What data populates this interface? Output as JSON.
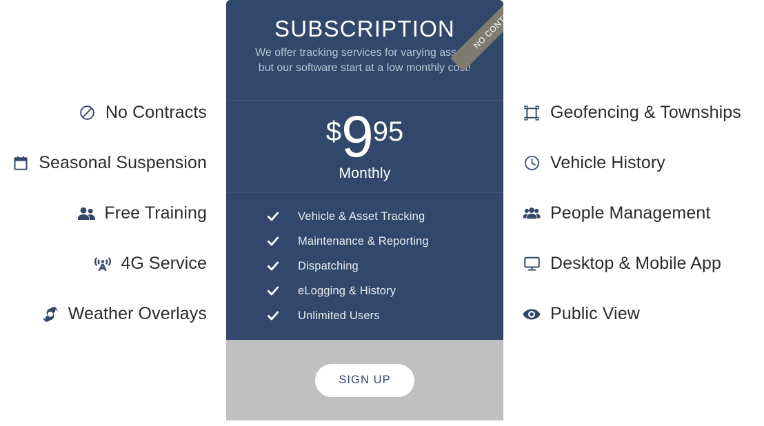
{
  "card": {
    "title": "SUBSCRIPTION",
    "subtitle": "We offer tracking services for varying assets, but our software start at a low monthly cost!",
    "ribbon_text": "NO CONTRACT",
    "price": {
      "currency": "$",
      "amount": "9",
      "cents": "95",
      "period": "Monthly"
    },
    "included": [
      {
        "label": "Vehicle & Asset Tracking",
        "icon": "check-icon"
      },
      {
        "label": "Maintenance & Reporting",
        "icon": "check-icon"
      },
      {
        "label": "Dispatching",
        "icon": "check-icon"
      },
      {
        "label": "eLogging & History",
        "icon": "check-icon"
      },
      {
        "label": "Unlimited Users",
        "icon": "check-icon"
      }
    ],
    "signup_label": "SIGN UP"
  },
  "left_features": [
    {
      "label": "No Contracts",
      "icon": "ban-icon"
    },
    {
      "label": "Seasonal Suspension",
      "icon": "calendar-times-icon"
    },
    {
      "label": "Free Training",
      "icon": "user-friends-icon"
    },
    {
      "label": "4G Service",
      "icon": "broadcast-tower-icon"
    },
    {
      "label": "Weather Overlays",
      "icon": "hurricane-icon"
    }
  ],
  "right_features": [
    {
      "label": "Geofencing & Townships",
      "icon": "vector-square-icon"
    },
    {
      "label": "Vehicle History",
      "icon": "clock-icon"
    },
    {
      "label": "People Management",
      "icon": "users-icon"
    },
    {
      "label": "Desktop & Mobile App",
      "icon": "desktop-icon"
    },
    {
      "label": "Public View",
      "icon": "eye-icon"
    }
  ],
  "colors": {
    "card_navy": "#32486a",
    "footer_grey": "#c0c0c0",
    "ribbon_taupe": "#7e7b6f",
    "icon_navy": "#32486a",
    "page_background": "#ffffff"
  }
}
